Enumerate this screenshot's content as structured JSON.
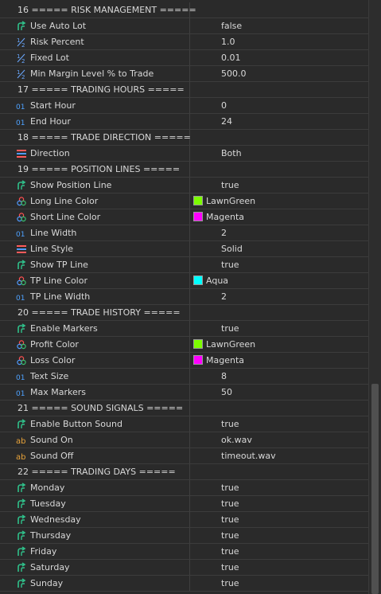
{
  "icons": {
    "bool": "bool-arrow-icon",
    "double": "fraction-icon",
    "int": "int-icon",
    "enum": "enum-list-icon",
    "color": "color-palette-icon",
    "string": "string-ab-icon"
  },
  "colors": {
    "bool": "#2fc08a",
    "double": "#6aa8ff",
    "int": "#4ea2ff",
    "enum_a": "#ff5a5a",
    "enum_b": "#4f9bff",
    "string": "#e8a33a"
  },
  "rows": [
    {
      "type": "section",
      "name": "16 ===== RISK MANAGEMENT ====="
    },
    {
      "type": "bool",
      "name": "Use Auto Lot",
      "value": "false"
    },
    {
      "type": "double",
      "name": "Risk Percent",
      "value": "1.0"
    },
    {
      "type": "double",
      "name": "Fixed Lot",
      "value": "0.01"
    },
    {
      "type": "double",
      "name": "Min Margin Level % to Trade",
      "value": "500.0"
    },
    {
      "type": "section",
      "name": "17 ===== TRADING HOURS ====="
    },
    {
      "type": "int",
      "name": "Start Hour",
      "value": "0"
    },
    {
      "type": "int",
      "name": "End Hour",
      "value": "24"
    },
    {
      "type": "section",
      "name": "18 ===== TRADE DIRECTION ====="
    },
    {
      "type": "enum",
      "name": "Direction",
      "value": "Both"
    },
    {
      "type": "section",
      "name": "19 ===== POSITION LINES ====="
    },
    {
      "type": "bool",
      "name": "Show Position Line",
      "value": "true"
    },
    {
      "type": "color",
      "name": "Long Line Color",
      "value": "LawnGreen",
      "swatch": "#7cfc00"
    },
    {
      "type": "color",
      "name": "Short Line Color",
      "value": "Magenta",
      "swatch": "#ff00ff"
    },
    {
      "type": "int",
      "name": "Line Width",
      "value": "2"
    },
    {
      "type": "enum",
      "name": "Line Style",
      "value": "Solid"
    },
    {
      "type": "bool",
      "name": "Show TP Line",
      "value": "true"
    },
    {
      "type": "color",
      "name": "TP Line Color",
      "value": "Aqua",
      "swatch": "#00ffff"
    },
    {
      "type": "int",
      "name": "TP Line Width",
      "value": "2"
    },
    {
      "type": "section",
      "name": "20 ===== TRADE HISTORY ====="
    },
    {
      "type": "bool",
      "name": "Enable Markers",
      "value": "true"
    },
    {
      "type": "color",
      "name": "Profit Color",
      "value": "LawnGreen",
      "swatch": "#7cfc00"
    },
    {
      "type": "color",
      "name": "Loss Color",
      "value": "Magenta",
      "swatch": "#ff00ff"
    },
    {
      "type": "int",
      "name": "Text Size",
      "value": "8"
    },
    {
      "type": "int",
      "name": "Max Markers",
      "value": "50"
    },
    {
      "type": "section",
      "name": "21 ===== SOUND SIGNALS ====="
    },
    {
      "type": "bool",
      "name": "Enable Button Sound",
      "value": "true"
    },
    {
      "type": "string",
      "name": "Sound On",
      "value": "ok.wav"
    },
    {
      "type": "string",
      "name": "Sound Off",
      "value": "timeout.wav"
    },
    {
      "type": "section",
      "name": "22 ===== TRADING DAYS ====="
    },
    {
      "type": "bool",
      "name": "Monday",
      "value": "true"
    },
    {
      "type": "bool",
      "name": "Tuesday",
      "value": "true"
    },
    {
      "type": "bool",
      "name": "Wednesday",
      "value": "true"
    },
    {
      "type": "bool",
      "name": "Thursday",
      "value": "true"
    },
    {
      "type": "bool",
      "name": "Friday",
      "value": "true"
    },
    {
      "type": "bool",
      "name": "Saturday",
      "value": "true"
    },
    {
      "type": "bool",
      "name": "Sunday",
      "value": "true"
    }
  ]
}
